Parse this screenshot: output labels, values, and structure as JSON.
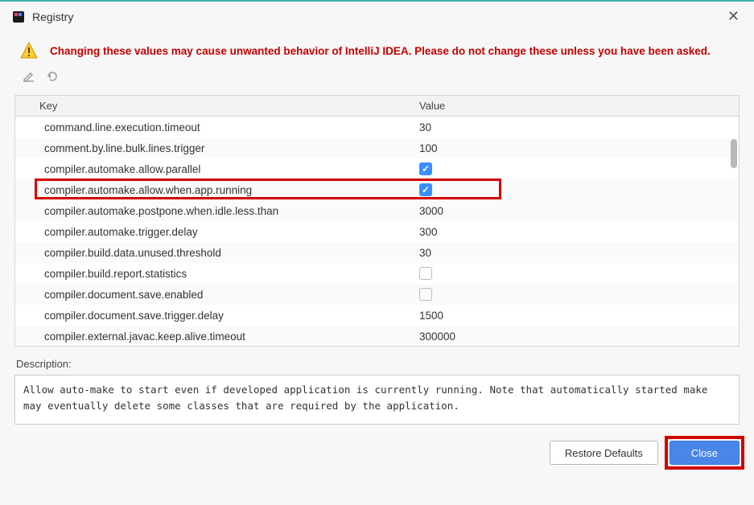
{
  "titlebar": {
    "title": "Registry"
  },
  "warning": "Changing these values may cause unwanted behavior of IntelliJ IDEA. Please do not change these unless you have been asked.",
  "table": {
    "headers": {
      "key": "Key",
      "value": "Value"
    },
    "rows": [
      {
        "key": "command.line.execution.timeout",
        "value": "30",
        "type": "text"
      },
      {
        "key": "comment.by.line.bulk.lines.trigger",
        "value": "100",
        "type": "text"
      },
      {
        "key": "compiler.automake.allow.parallel",
        "checked": true,
        "type": "bool"
      },
      {
        "key": "compiler.automake.allow.when.app.running",
        "checked": true,
        "type": "bool",
        "highlighted": true
      },
      {
        "key": "compiler.automake.postpone.when.idle.less.than",
        "value": "3000",
        "type": "text"
      },
      {
        "key": "compiler.automake.trigger.delay",
        "value": "300",
        "type": "text"
      },
      {
        "key": "compiler.build.data.unused.threshold",
        "value": "30",
        "type": "text"
      },
      {
        "key": "compiler.build.report.statistics",
        "checked": false,
        "type": "bool"
      },
      {
        "key": "compiler.document.save.enabled",
        "checked": false,
        "type": "bool"
      },
      {
        "key": "compiler.document.save.trigger.delay",
        "value": "1500",
        "type": "text"
      },
      {
        "key": "compiler.external.javac.keep.alive.timeout",
        "value": "300000",
        "type": "text"
      }
    ]
  },
  "description": {
    "label": "Description:",
    "text": "Allow auto-make to start even if developed application is currently running. Note that automatically started make may eventually delete some classes that are required by the application."
  },
  "footer": {
    "restore": "Restore Defaults",
    "close": "Close"
  }
}
